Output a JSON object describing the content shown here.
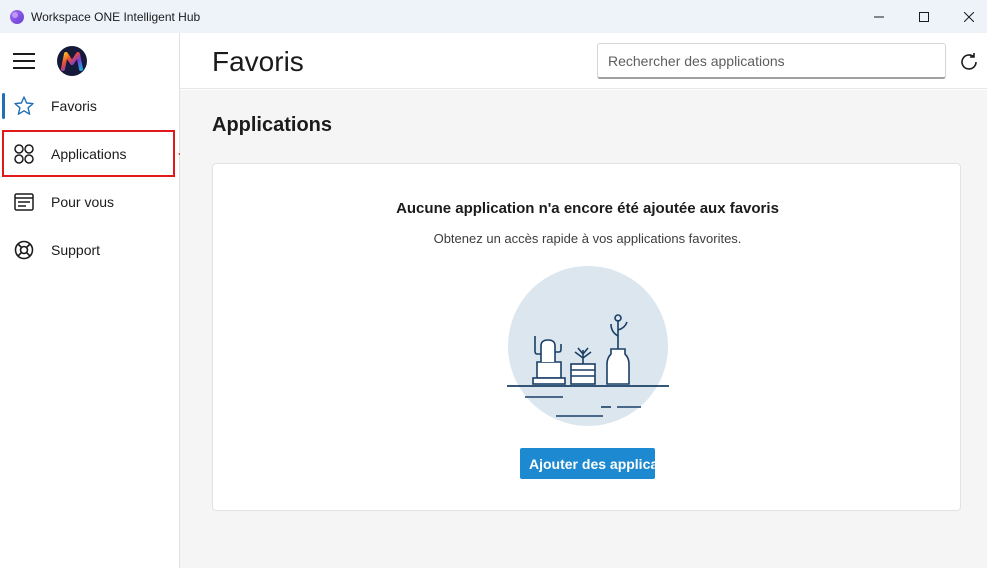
{
  "window": {
    "title": "Workspace ONE Intelligent Hub",
    "controls": {
      "minimize": "minimize-icon",
      "maximize": "maximize-icon",
      "close": "close-icon"
    }
  },
  "sidebar": {
    "menu_icon": "hamburger-icon",
    "logo_icon": "vmware-m-logo",
    "items": [
      {
        "label": "Favoris",
        "icon": "star-icon",
        "active": true
      },
      {
        "label": "Applications",
        "icon": "apps-grid-icon",
        "active": false
      },
      {
        "label": "Pour vous",
        "icon": "feed-icon",
        "active": false
      },
      {
        "label": "Support",
        "icon": "lifebuoy-icon",
        "active": false
      }
    ]
  },
  "header": {
    "title": "Favoris",
    "search_placeholder": "Rechercher des applications",
    "refresh_icon": "refresh-icon"
  },
  "main": {
    "section_title": "Applications",
    "empty_state": {
      "title": "Aucune application n'a encore été ajoutée aux favoris",
      "subtitle": "Obtenez un accès rapide à vos applications favorites.",
      "illustration": "potted-plants-illustration",
      "button_label": "Ajouter des applications"
    }
  },
  "annotation": {
    "highlight_color": "#e0191b",
    "target": "Applications"
  },
  "colors": {
    "accent": "#1d89d0",
    "active_indicator": "#1f6fb5",
    "illustration_bg": "#dce6ee",
    "illustration_stroke": "#1a3f66"
  }
}
